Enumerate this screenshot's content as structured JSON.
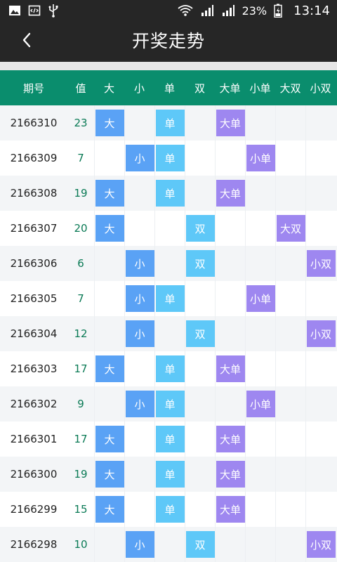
{
  "status_bar": {
    "battery_percent": "23%",
    "time": "13:14"
  },
  "header": {
    "title": "开奖走势"
  },
  "table": {
    "headers": [
      "期号",
      "值",
      "大",
      "小",
      "单",
      "双",
      "大单",
      "小单",
      "大双",
      "小双"
    ],
    "chip_colors": {
      "大": "#5aa2f5",
      "小": "#5aa2f5",
      "单": "#5ec8f8",
      "双": "#5ec8f8",
      "大单": "#9e87f0",
      "小单": "#9e87f0",
      "大双": "#9e87f0",
      "小双": "#9e87f0"
    },
    "rows": [
      {
        "issue": "2166310",
        "value": "23",
        "marks": [
          "大",
          "",
          "单",
          "",
          "大单",
          "",
          "",
          ""
        ]
      },
      {
        "issue": "2166309",
        "value": "7",
        "marks": [
          "",
          "小",
          "单",
          "",
          "",
          "小单",
          "",
          ""
        ]
      },
      {
        "issue": "2166308",
        "value": "19",
        "marks": [
          "大",
          "",
          "单",
          "",
          "大单",
          "",
          "",
          ""
        ]
      },
      {
        "issue": "2166307",
        "value": "20",
        "marks": [
          "大",
          "",
          "",
          "双",
          "",
          "",
          "大双",
          ""
        ]
      },
      {
        "issue": "2166306",
        "value": "6",
        "marks": [
          "",
          "小",
          "",
          "双",
          "",
          "",
          "",
          "小双"
        ]
      },
      {
        "issue": "2166305",
        "value": "7",
        "marks": [
          "",
          "小",
          "单",
          "",
          "",
          "小单",
          "",
          ""
        ]
      },
      {
        "issue": "2166304",
        "value": "12",
        "marks": [
          "",
          "小",
          "",
          "双",
          "",
          "",
          "",
          "小双"
        ]
      },
      {
        "issue": "2166303",
        "value": "17",
        "marks": [
          "大",
          "",
          "单",
          "",
          "大单",
          "",
          "",
          ""
        ]
      },
      {
        "issue": "2166302",
        "value": "9",
        "marks": [
          "",
          "小",
          "单",
          "",
          "",
          "小单",
          "",
          ""
        ]
      },
      {
        "issue": "2166301",
        "value": "17",
        "marks": [
          "大",
          "",
          "单",
          "",
          "大单",
          "",
          "",
          ""
        ]
      },
      {
        "issue": "2166300",
        "value": "19",
        "marks": [
          "大",
          "",
          "单",
          "",
          "大单",
          "",
          "",
          ""
        ]
      },
      {
        "issue": "2166299",
        "value": "15",
        "marks": [
          "大",
          "",
          "单",
          "",
          "大单",
          "",
          "",
          ""
        ]
      },
      {
        "issue": "2166298",
        "value": "10",
        "marks": [
          "",
          "小",
          "",
          "双",
          "",
          "",
          "",
          "小双"
        ]
      }
    ]
  }
}
